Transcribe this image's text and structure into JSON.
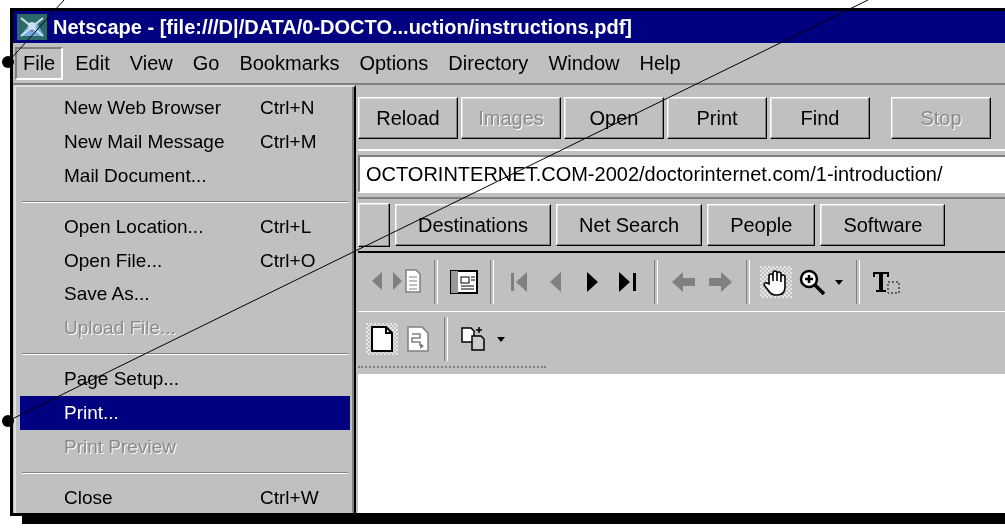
{
  "window": {
    "title": "Netscape - [file:///D|/DATA/0-DOCTO...uction/instructions.pdf]"
  },
  "menu_bar": [
    {
      "label": "File",
      "selected": true
    },
    {
      "label": "Edit",
      "selected": false
    },
    {
      "label": "View",
      "selected": false
    },
    {
      "label": "Go",
      "selected": false
    },
    {
      "label": "Bookmarks",
      "selected": false
    },
    {
      "label": "Options",
      "selected": false
    },
    {
      "label": "Directory",
      "selected": false
    },
    {
      "label": "Window",
      "selected": false
    },
    {
      "label": "Help",
      "selected": false
    }
  ],
  "file_menu": [
    {
      "kind": "item",
      "label": "New Web Browser",
      "shortcut": "Ctrl+N",
      "disabled": false,
      "selected": false
    },
    {
      "kind": "item",
      "label": "New Mail Message",
      "shortcut": "Ctrl+M",
      "disabled": false,
      "selected": false
    },
    {
      "kind": "item",
      "label": "Mail Document...",
      "disabled": false,
      "selected": false
    },
    {
      "kind": "separator"
    },
    {
      "kind": "item",
      "label": "Open Location...",
      "shortcut": "Ctrl+L",
      "disabled": false,
      "selected": false
    },
    {
      "kind": "item",
      "label": "Open File...",
      "shortcut": "Ctrl+O",
      "disabled": false,
      "selected": false
    },
    {
      "kind": "item",
      "label": "Save As...",
      "disabled": false,
      "selected": false
    },
    {
      "kind": "item",
      "label": "Upload File...",
      "disabled": true,
      "selected": false
    },
    {
      "kind": "separator"
    },
    {
      "kind": "item",
      "label": "Page Setup...",
      "disabled": false,
      "selected": false
    },
    {
      "kind": "item",
      "label": "Print...",
      "disabled": false,
      "selected": true
    },
    {
      "kind": "item",
      "label": "Print Preview",
      "disabled": true,
      "selected": false
    },
    {
      "kind": "separator"
    },
    {
      "kind": "item",
      "label": "Close",
      "shortcut": "Ctrl+W",
      "disabled": false,
      "selected": false
    }
  ],
  "toolbar_buttons": [
    {
      "label": "Reload",
      "disabled": false
    },
    {
      "label": "Images",
      "disabled": true
    },
    {
      "label": "Open",
      "disabled": false
    },
    {
      "label": "Print",
      "disabled": false
    },
    {
      "label": "Find",
      "disabled": false
    },
    {
      "label": "Stop",
      "disabled": true
    }
  ],
  "location": {
    "value": "OCTORINTERNET.COM-2002/doctorinternet.com/1-introduction/"
  },
  "directory_buttons": [
    "Destinations",
    "Net Search",
    "People",
    "Software"
  ],
  "pdf_toolbar": [
    {
      "kind": "prev-document",
      "disabled": true,
      "selected": false
    },
    {
      "kind": "next-document",
      "disabled": true,
      "selected": false
    },
    {
      "kind": "separator"
    },
    {
      "kind": "panel",
      "disabled": false,
      "selected": false
    },
    {
      "kind": "separator"
    },
    {
      "kind": "first-page",
      "disabled": true,
      "selected": false
    },
    {
      "kind": "prev-page",
      "disabled": true,
      "selected": false
    },
    {
      "kind": "next-page",
      "disabled": false,
      "selected": false
    },
    {
      "kind": "last-page",
      "disabled": false,
      "selected": false
    },
    {
      "kind": "separator"
    },
    {
      "kind": "go-back",
      "disabled": true,
      "selected": false
    },
    {
      "kind": "go-forward",
      "disabled": true,
      "selected": false
    },
    {
      "kind": "separator"
    },
    {
      "kind": "hand",
      "disabled": false,
      "selected": true
    },
    {
      "kind": "zoom-in",
      "disabled": false,
      "selected": false
    },
    {
      "kind": "dropdown",
      "disabled": false,
      "selected": false
    },
    {
      "kind": "separator"
    },
    {
      "kind": "text-select",
      "disabled": false,
      "selected": false
    }
  ],
  "pdf_toolbar_2": [
    {
      "kind": "single-page",
      "disabled": false,
      "selected": true
    },
    {
      "kind": "continuous",
      "disabled": true,
      "selected": false
    },
    {
      "kind": "separator"
    },
    {
      "kind": "page-options",
      "disabled": false,
      "selected": false
    },
    {
      "kind": "dropdown",
      "disabled": false,
      "selected": false
    }
  ]
}
